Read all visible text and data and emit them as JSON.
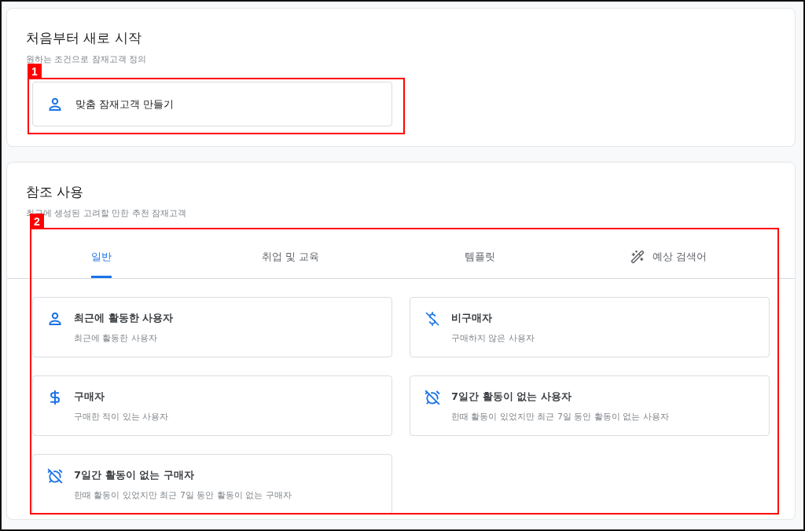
{
  "start_section": {
    "title": "처음부터 새로 시작",
    "subtitle": "원하는 조건으로 잠재고객 정의",
    "create_button": {
      "label": "맞춤 잠재고객 만들기"
    }
  },
  "reference_section": {
    "title": "참조 사용",
    "subtitle": "최근에 생성된 고려할 만한 추천 잠재고객",
    "tabs": [
      {
        "label": "일반",
        "selected": true,
        "kind": "text"
      },
      {
        "label": "취업 및 교육",
        "selected": false,
        "kind": "text"
      },
      {
        "label": "템플릿",
        "selected": false,
        "kind": "text"
      },
      {
        "label": "예상 검색어",
        "selected": false,
        "kind": "wand"
      }
    ],
    "audiences": [
      {
        "kind": "person",
        "title": "최근에 활동한 사용자",
        "description": "최근에 활동한 사용자"
      },
      {
        "kind": "dollar-off",
        "title": "비구매자",
        "description": "구매하지 않은 사용자"
      },
      {
        "kind": "dollar",
        "title": "구매자",
        "description": "구매한 적이 있는 사용자"
      },
      {
        "kind": "alarm-off",
        "title": "7일간 활동이 없는 사용자",
        "description": "한때 활동이 있었지만 최근 7일 동안 활동이 없는 사용자"
      },
      {
        "kind": "alarm-off",
        "title": "7일간 활동이 없는 구매자",
        "description": "한때 활동이 있었지만 최근 7일 동안 활동이 없는 구매자"
      }
    ]
  },
  "annotations": [
    {
      "label": "1"
    },
    {
      "label": "2"
    }
  ]
}
